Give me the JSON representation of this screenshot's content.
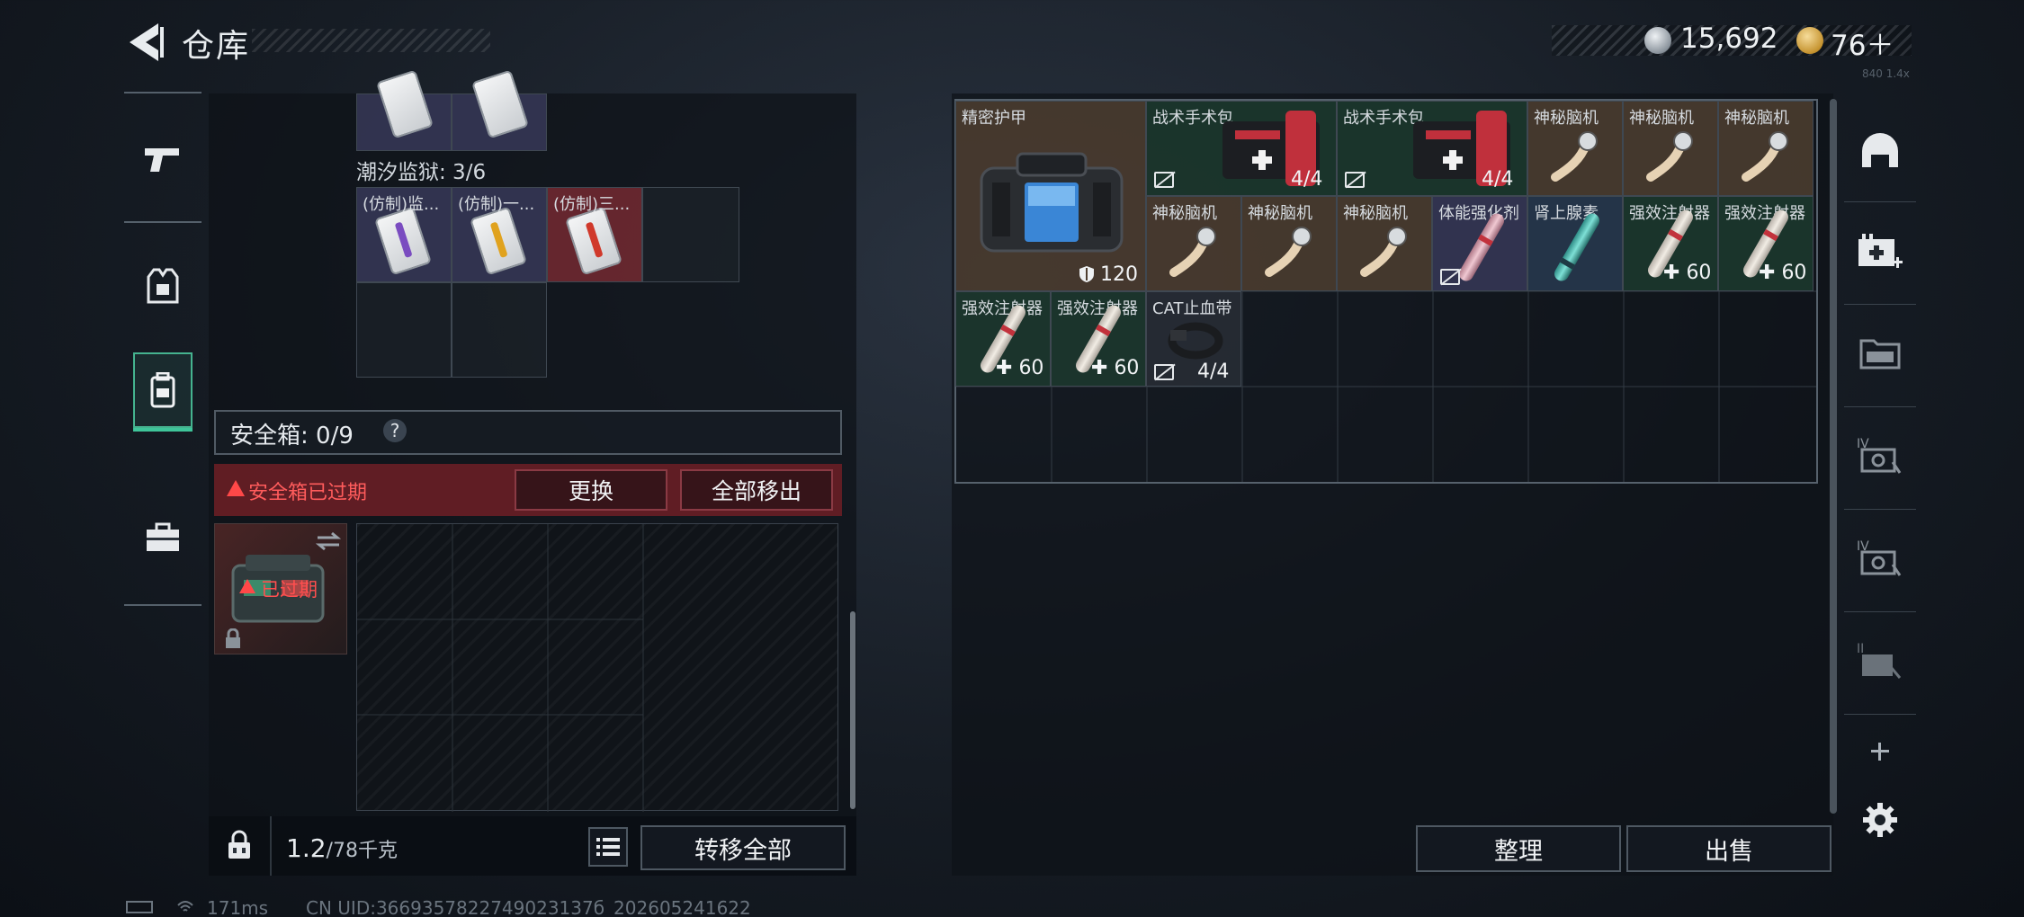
{
  "header": {
    "title": "仓库"
  },
  "currency": {
    "silver": "15,692",
    "gold": "76＋",
    "tiny": "840 1.4x"
  },
  "left_nav": [
    "weapon-icon",
    "vest-icon",
    "backpack-icon",
    "briefcase-icon"
  ],
  "prison": {
    "label": "潮汐监狱: 3/6",
    "items": [
      {
        "label": "(仿制)监...",
        "stripe": "#7a4cc0",
        "color": "purple"
      },
      {
        "label": "(仿制)一...",
        "stripe": "#e0a21e",
        "color": "purple"
      },
      {
        "label": "(仿制)三...",
        "stripe": "#d0392b",
        "color": "red"
      }
    ]
  },
  "safebox": {
    "title": "安全箱: 0/9",
    "help": "?",
    "expired_text": "安全箱已过期",
    "replace_label": "更换",
    "remove_all_label": "全部移出",
    "case_expired": "已过期"
  },
  "footer_left": {
    "weight_value": "1.2",
    "weight_unit": "/78千克",
    "transfer_all_label": "转移全部"
  },
  "inventory": {
    "armor": {
      "label": "精密护甲",
      "durability": "120"
    },
    "items": [
      {
        "label": "战术手术包",
        "count": "4/4",
        "type": "medkit"
      },
      {
        "label": "战术手术包",
        "count": "4/4",
        "type": "medkit"
      },
      {
        "label": "神秘脑机",
        "type": "nerve"
      },
      {
        "label": "神秘脑机",
        "type": "nerve"
      },
      {
        "label": "神秘脑机",
        "type": "nerve"
      },
      {
        "label": "神秘脑机",
        "type": "nerve"
      },
      {
        "label": "神秘脑机",
        "type": "nerve"
      },
      {
        "label": "神秘脑机",
        "type": "nerve"
      },
      {
        "label": "体能强化剂",
        "type": "syringe-red"
      },
      {
        "label": "肾上腺素",
        "type": "syringe-teal"
      },
      {
        "label": "强效注射器",
        "heal": "60",
        "type": "syringe"
      },
      {
        "label": "强效注射器",
        "heal": "60",
        "type": "syringe"
      },
      {
        "label": "强效注射器",
        "heal": "60",
        "type": "syringe"
      },
      {
        "label": "强效注射器",
        "heal": "60",
        "type": "syringe"
      },
      {
        "label": "CAT止血带",
        "count": "4/4",
        "type": "tourniquet"
      }
    ],
    "sort_label": "整理",
    "sell_label": "出售"
  },
  "right_nav": [
    "helmet-icon",
    "medkit-add-icon",
    "folder-icon",
    "safe-iv-icon",
    "safe-iv-icon-2",
    "safe-ii-icon",
    "plus-icon",
    "gear-icon"
  ],
  "status": {
    "ping": "171ms",
    "uid": "CN UID:3669357822749023137б_202605241622"
  },
  "colors": {
    "accent": "#3fc59a",
    "danger": "#ff4f4f",
    "gold": "#c5932f"
  }
}
